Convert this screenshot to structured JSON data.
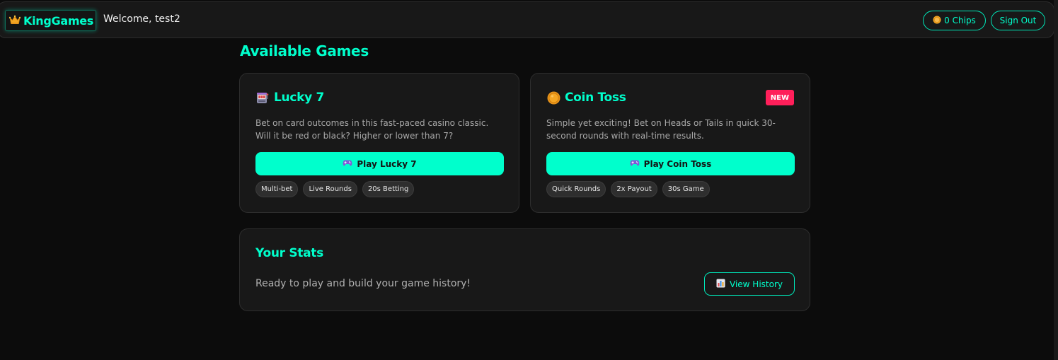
{
  "header": {
    "brand": "KingGames",
    "brand_icon": "crown-icon",
    "welcome": "Welcome, test2",
    "chips": "0 Chips",
    "chips_icon": "coin-icon",
    "sign_out": "Sign Out"
  },
  "main": {
    "section_title": "Available Games",
    "games": [
      {
        "icon": "slot-machine-icon",
        "title": "Lucky 7",
        "description": "Bet on card outcomes in this fast-paced casino classic. Will it be red or black? Higher or lower than 7?",
        "play_label": "Play Lucky 7",
        "play_icon": "gamepad-icon",
        "tags": [
          "Multi-bet",
          "Live Rounds",
          "20s Betting"
        ]
      },
      {
        "icon": "coin-icon",
        "title": "Coin Toss",
        "badge": "NEW",
        "description": "Simple yet exciting! Bet on Heads or Tails in quick 30-second rounds with real-time results.",
        "play_label": "Play Coin Toss",
        "play_icon": "gamepad-icon",
        "tags": [
          "Quick Rounds",
          "2x Payout",
          "30s Game"
        ]
      }
    ],
    "stats": {
      "title": "Your Stats",
      "text": "Ready to play and build your game history!",
      "history_label": "View History",
      "history_icon": "bar-chart-icon"
    }
  },
  "colors": {
    "accent": "#00ffcc",
    "background": "#0c0c0c",
    "card": "#181818",
    "badge": "#ff1f5a"
  }
}
